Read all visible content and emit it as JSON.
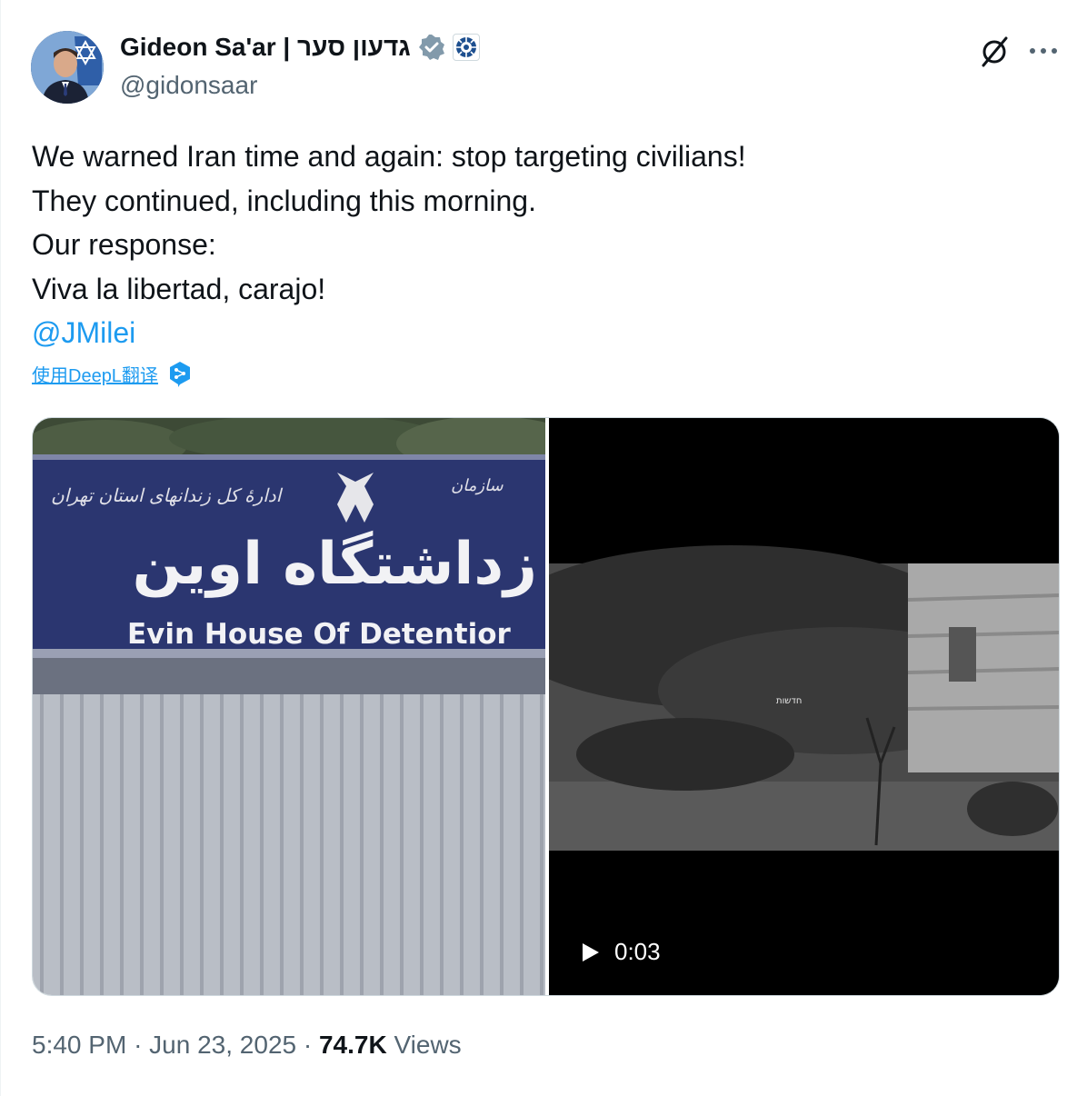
{
  "author": {
    "name": "Gideon Sa'ar | גדעון סער",
    "handle": "@gidonsaar"
  },
  "tweet": {
    "lines": [
      "We warned Iran time and again: stop targeting civilians!",
      "They continued, including this morning.",
      "Our response:",
      "Viva la libertad, carajo!"
    ],
    "mention": "@JMilei",
    "translate_label": "使用DeepL翻译"
  },
  "media": {
    "image_left": {
      "sign_text": "Evin House Of Detentior",
      "sign_farsi": "زداشتگاه اوین"
    },
    "video": {
      "duration": "0:03",
      "watermark": "חדשות"
    }
  },
  "meta": {
    "time": "5:40 PM",
    "separator": "·",
    "date": "Jun 23, 2025",
    "views_count": "74.7K",
    "views_label": "Views"
  },
  "colors": {
    "accent": "#1d9bf0",
    "text": "#0f1419",
    "secondary": "#536471",
    "sign_blue": "#2b3670"
  },
  "icons": [
    "verified-badge-icon",
    "organization-badge-icon",
    "grok-icon",
    "more-icon",
    "deepl-icon",
    "play-icon"
  ]
}
